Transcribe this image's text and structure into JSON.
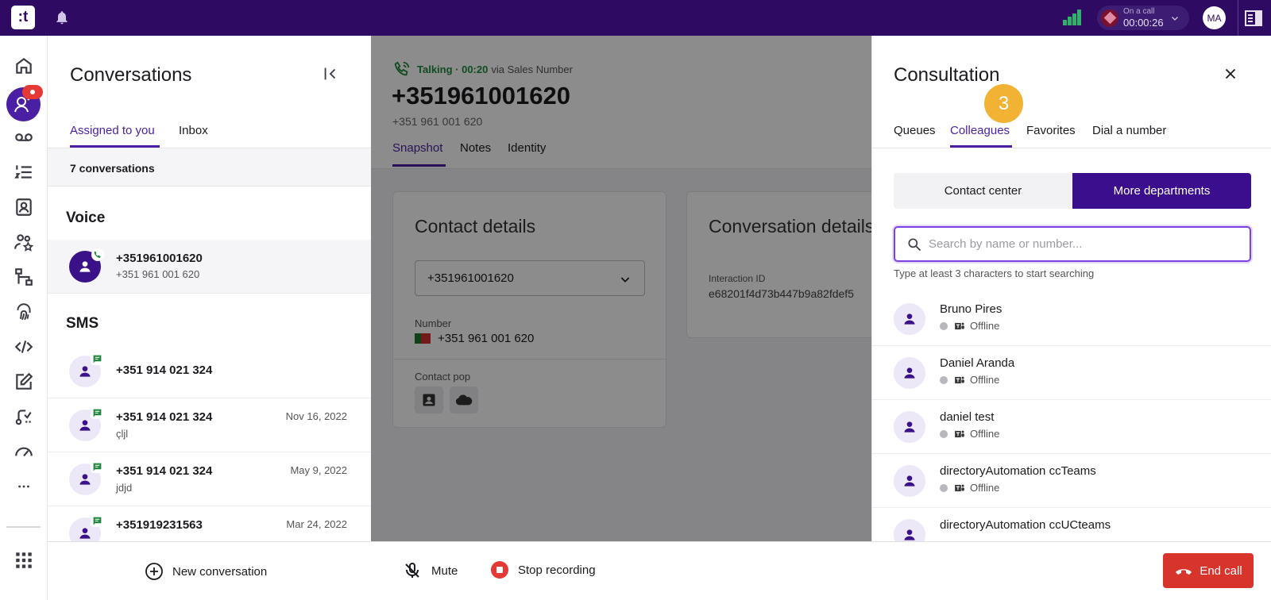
{
  "topbar": {
    "logo_text": ":t",
    "call_status_label": "On a call",
    "call_timer": "00:00:26",
    "user_initials": "MA"
  },
  "conversations": {
    "title": "Conversations",
    "tabs": [
      {
        "label": "Assigned to you",
        "active": true
      },
      {
        "label": "Inbox",
        "active": false
      }
    ],
    "count_text": "7 conversations",
    "voice_heading": "Voice",
    "voice_items": [
      {
        "title": "+351961001620",
        "subtitle": "+351 961 001 620"
      }
    ],
    "sms_heading": "SMS",
    "sms_items": [
      {
        "title": "+351 914 021 324",
        "subtitle": "",
        "date": ""
      },
      {
        "title": "+351 914 021 324",
        "subtitle": "çljl",
        "date": "Nov 16, 2022"
      },
      {
        "title": "+351 914 021 324",
        "subtitle": "jdjd",
        "date": "May 9, 2022"
      },
      {
        "title": "+351919231563",
        "subtitle": "",
        "date": "Mar 24, 2022"
      }
    ],
    "new_conversation_label": "New conversation"
  },
  "call": {
    "status": "Talking · 00:20",
    "via": "via Sales Number",
    "number": "+351961001620",
    "number_formatted": "+351 961 001 620",
    "tabs": [
      "Snapshot",
      "Notes",
      "Identity"
    ],
    "contact_details": {
      "title": "Contact details",
      "selected_contact": "+351961001620",
      "number_label": "Number",
      "number_value": "+351 961 001 620",
      "contact_pop_label": "Contact pop"
    },
    "conversation_details": {
      "title": "Conversation details",
      "interaction_id_label": "Interaction ID",
      "interaction_id": "e68201f4d73b447b9a82fdef5"
    }
  },
  "actions": {
    "mute_label": "Mute",
    "stop_recording_label": "Stop recording",
    "end_call_label": "End call"
  },
  "consultation": {
    "title": "Consultation",
    "step_badge": "3",
    "tabs": [
      {
        "label": "Queues",
        "active": false
      },
      {
        "label": "Colleagues",
        "active": true
      },
      {
        "label": "Favorites",
        "active": false
      },
      {
        "label": "Dial a number",
        "active": false
      }
    ],
    "segments": [
      {
        "label": "Contact center",
        "active": false
      },
      {
        "label": "More departments",
        "active": true
      }
    ],
    "search_placeholder": "Search by name or number...",
    "search_hint": "Type at least 3 characters to start searching",
    "people": [
      {
        "name": "Bruno Pires",
        "status": "Offline"
      },
      {
        "name": "Daniel Aranda",
        "status": "Offline"
      },
      {
        "name": "daniel test",
        "status": "Offline"
      },
      {
        "name": "directoryAutomation ccTeams",
        "status": "Offline"
      },
      {
        "name": "directoryAutomation ccUCteams",
        "status": ""
      }
    ]
  },
  "colors": {
    "topbar_bg": "#2e0a63",
    "accent_purple": "#4b1fa3",
    "segment_active": "#3a0e8c",
    "talking_green": "#1f8a3c",
    "end_call_red": "#d7342b",
    "step_badge": "#f2b233"
  }
}
